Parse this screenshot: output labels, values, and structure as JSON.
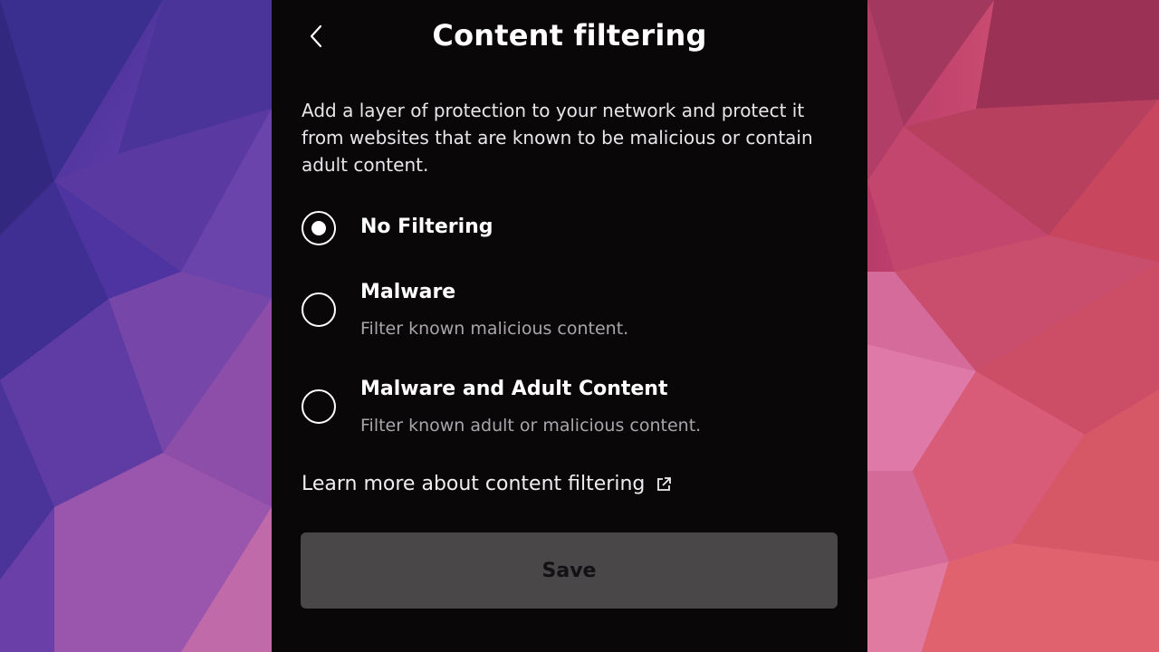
{
  "header": {
    "title": "Content filtering",
    "back_icon": "chevron-left-icon"
  },
  "description": "Add a layer of protection to your network and protect it from websites that are known to be malicious or contain adult content.",
  "options": [
    {
      "label": "No Filtering",
      "sublabel": "",
      "selected": true
    },
    {
      "label": "Malware",
      "sublabel": "Filter known malicious content.",
      "selected": false
    },
    {
      "label": "Malware and Adult Content",
      "sublabel": "Filter known adult or malicious content.",
      "selected": false
    }
  ],
  "learn_more": {
    "label": "Learn more about content filtering",
    "icon": "external-link-icon"
  },
  "save": {
    "label": "Save",
    "enabled": false
  },
  "colors": {
    "panel_background": "#0a0709",
    "button_disabled": "#4a4749",
    "secondary_text": "#a9a6aa"
  }
}
